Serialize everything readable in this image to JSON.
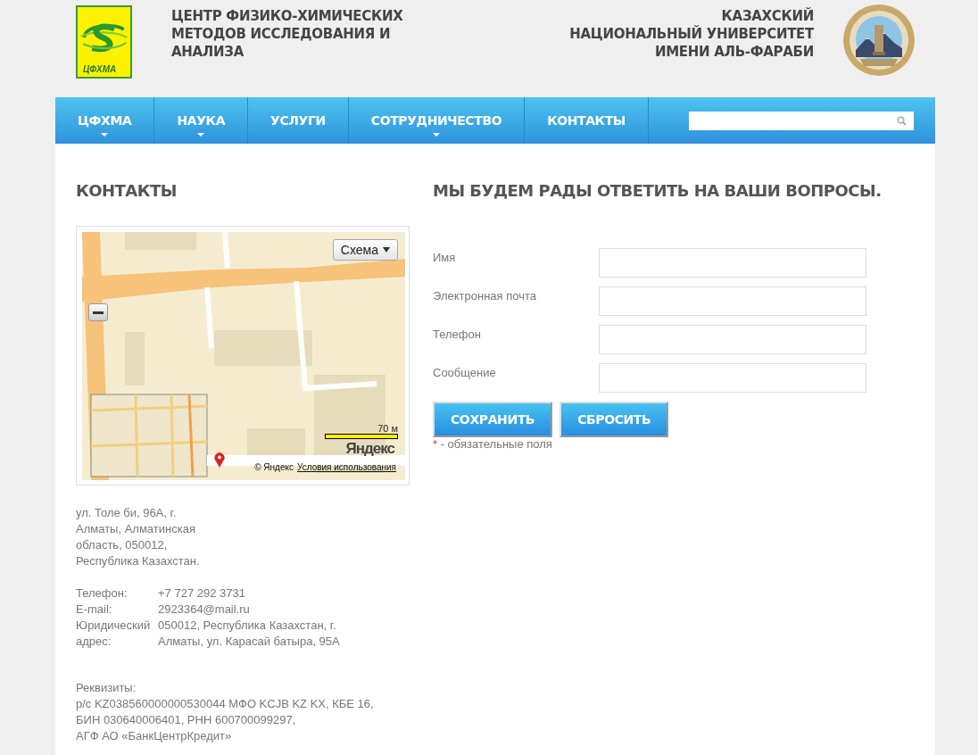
{
  "header": {
    "logo_text": "ЦФХМА",
    "title": "ЦЕНТР ФИЗИКО-ХИМИЧЕСКИХ МЕТОДОВ ИССЛЕДОВАНИЯ И АНАЛИЗА",
    "university": [
      "КАЗАХСКИЙ",
      "НАЦИОНАЛЬНЫЙ УНИВЕРСИТЕТ",
      "ИМЕНИ АЛЬ-ФАРАБИ"
    ]
  },
  "nav": {
    "items": [
      {
        "label": "ЦФХМА",
        "dropdown": true
      },
      {
        "label": "НАУКА",
        "dropdown": true
      },
      {
        "label": "УСЛУГИ",
        "dropdown": false
      },
      {
        "label": "СОТРУДНИЧЕСТВО",
        "dropdown": true
      },
      {
        "label": "КОНТАКТЫ",
        "dropdown": false
      }
    ]
  },
  "contacts": {
    "heading": "КОНТАКТЫ",
    "map": {
      "kind": "picture",
      "type_button": "Схема",
      "scale": "70 м",
      "logo": "Яндекс",
      "copyright": "© Яндекс",
      "terms_link": "Условия использования"
    },
    "address": [
      "ул. Толе би, 96А, г.",
      "Алматы, Алматинская",
      "область, 050012,",
      "Республика Казахстан."
    ],
    "details": [
      {
        "label": "Телефон:",
        "value": "+7 727 292 3731"
      },
      {
        "label": "E-mail:",
        "value": "2923364@mail.ru"
      },
      {
        "label": "Юридический адрес:",
        "value": "050012, Республика Казахстан, г. Алматы, ул. Карасай батыра, 95А"
      }
    ],
    "requisites": [
      "Реквизиты:",
      "р/с KZ038560000000530044 МФО KCJB KZ KX, КБЕ 16,",
      "БИН 030640006401, РНН 600700099297,",
      "АГФ АО «БанкЦентрКредит»"
    ]
  },
  "form": {
    "heading": "МЫ БУДЕМ РАДЫ ОТВЕТИТЬ НА ВАШИ ВОПРОСЫ.",
    "fields": [
      {
        "label": "Имя"
      },
      {
        "label": "Электронная почта"
      },
      {
        "label": "Телефон"
      },
      {
        "label": "Сообщение"
      }
    ],
    "buttons": [
      "СОХРАНИТЬ",
      "СБРОСИТЬ"
    ],
    "required_mark": "*",
    "required_note": "- обязательные поля"
  }
}
